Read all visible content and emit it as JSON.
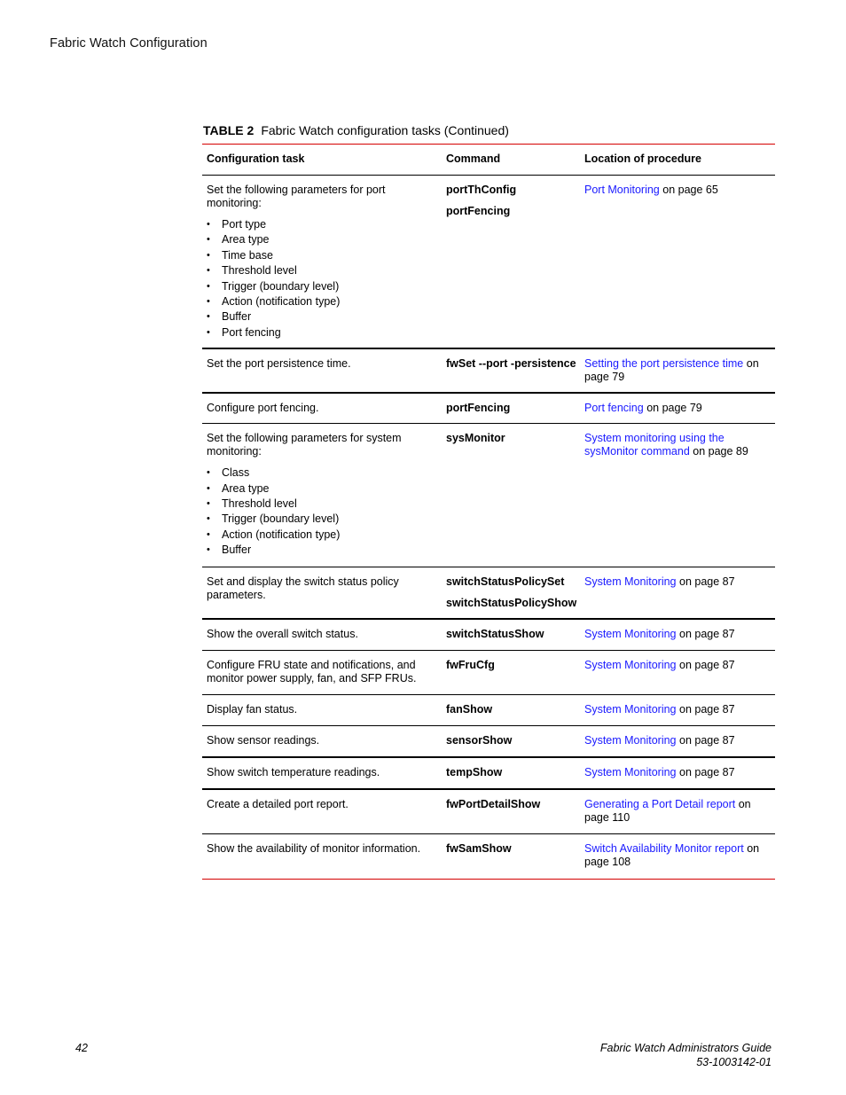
{
  "page": {
    "running_head": "Fabric Watch Configuration",
    "footer": {
      "page_number": "42",
      "doc_title": "Fabric Watch Administrators Guide",
      "doc_number": "53-1003142-01"
    }
  },
  "table": {
    "label": "TABLE 2",
    "title": "Fabric Watch configuration tasks (Continued)",
    "colors": {
      "rule": "#d40000",
      "link": "#1a1aff"
    },
    "headers": [
      "Configuration task",
      "Command",
      "Location of procedure"
    ],
    "rows": [
      {
        "task": "Set the following parameters for port monitoring:",
        "bullets": [
          "Port type",
          "Area type",
          "Time base",
          "Threshold level",
          "Trigger (boundary level)",
          "Action (notification type)",
          "Buffer",
          "Port fencing"
        ],
        "commands": [
          "portThConfig",
          "portFencing"
        ],
        "link": "Port Monitoring",
        "suffix": " on page 65"
      },
      {
        "task": "Set the port persistence time.",
        "commands": [
          "fwSet --port -persistence"
        ],
        "link": "Setting the port persistence time",
        "suffix": " on page 79"
      },
      {
        "task": "Configure port fencing.",
        "commands": [
          "portFencing"
        ],
        "link": "Port fencing",
        "suffix": " on page 79"
      },
      {
        "task": "Set the following parameters for system monitoring:",
        "bullets": [
          "Class",
          "Area type",
          "Threshold level",
          "Trigger (boundary level)",
          "Action (notification type)",
          "Buffer"
        ],
        "commands": [
          "sysMonitor"
        ],
        "link": "System monitoring using the sysMonitor command",
        "suffix": " on page 89"
      },
      {
        "task": "Set and display the switch status policy parameters.",
        "commands": [
          "switchStatusPolicySet",
          "switchStatusPolicyShow"
        ],
        "link": "System Monitoring",
        "suffix": " on page 87"
      },
      {
        "task": "Show the overall switch status.",
        "commands": [
          "switchStatusShow"
        ],
        "link": "System Monitoring",
        "suffix": " on page 87"
      },
      {
        "task": "Configure FRU state and notifications, and monitor power supply, fan, and SFP FRUs.",
        "commands": [
          "fwFruCfg"
        ],
        "link": "System Monitoring",
        "suffix": " on page 87"
      },
      {
        "task": "Display fan status.",
        "commands": [
          "fanShow"
        ],
        "link": "System Monitoring",
        "suffix": " on page 87"
      },
      {
        "task": "Show sensor readings.",
        "commands": [
          "sensorShow"
        ],
        "link": "System Monitoring",
        "suffix": " on page 87"
      },
      {
        "task": "Show switch temperature readings.",
        "commands": [
          "tempShow"
        ],
        "link": "System Monitoring",
        "suffix": " on page 87"
      },
      {
        "task": "Create a detailed port report.",
        "commands": [
          "fwPortDetailShow"
        ],
        "link": "Generating a Port Detail report",
        "suffix": " on page 110"
      },
      {
        "task": "Show the availability of monitor information.",
        "commands": [
          "fwSamShow"
        ],
        "link": "Switch Availability Monitor report",
        "suffix": " on page 108"
      }
    ]
  }
}
